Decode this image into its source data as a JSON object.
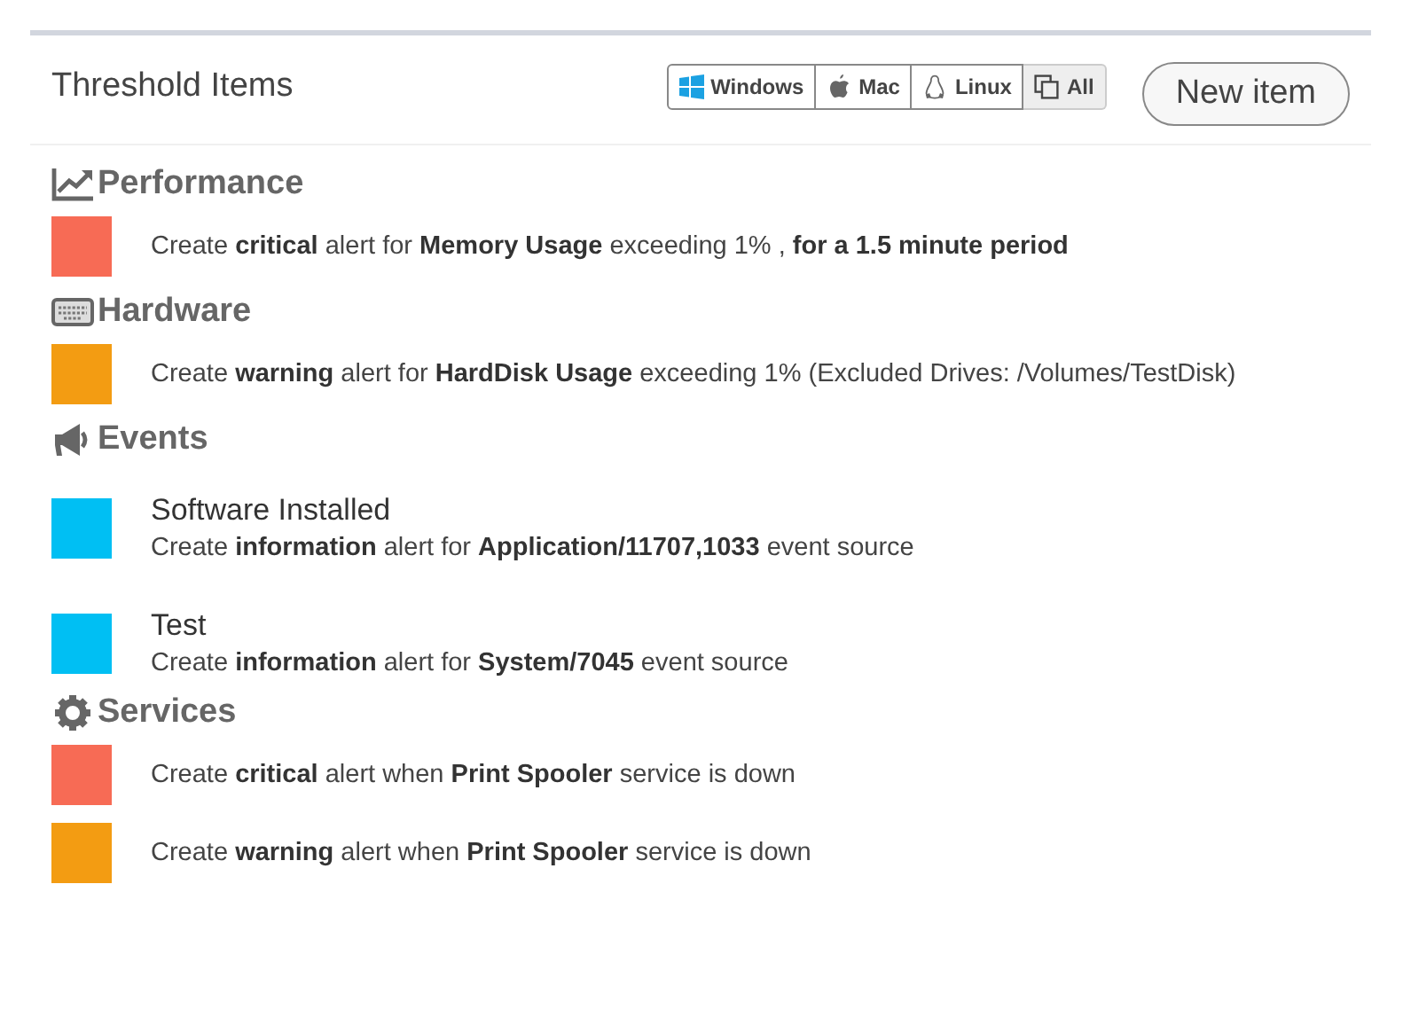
{
  "title": "Threshold Items",
  "filters": [
    {
      "label": "Windows",
      "kind": "windows",
      "selected": false
    },
    {
      "label": "Mac",
      "kind": "mac",
      "selected": false
    },
    {
      "label": "Linux",
      "kind": "linux",
      "selected": false
    },
    {
      "label": "All",
      "kind": "all",
      "selected": true
    }
  ],
  "new_button": "New item",
  "sections": [
    {
      "title": "Performance",
      "kind": "performance",
      "items": [
        {
          "color": "#f76b55",
          "text": "Create **critical** alert for **Memory Usage** exceeding 1% , **for a 1.5 minute period**"
        }
      ]
    },
    {
      "title": "Hardware",
      "kind": "hardware",
      "items": [
        {
          "color": "#f39c12",
          "text": "Create **warning** alert for **HardDisk Usage** exceeding 1% (Excluded Drives: /Volumes/TestDisk)"
        }
      ]
    },
    {
      "title": "Events",
      "kind": "events",
      "items": [
        {
          "color": "#00bff3",
          "name": "Software Installed",
          "text": "Create **information** alert for **Application/11707,1033** event source"
        },
        {
          "color": "#00bff3",
          "name": "Test",
          "text": "Create **information** alert for **System/7045** event source"
        }
      ]
    },
    {
      "title": "Services",
      "kind": "services",
      "items": [
        {
          "color": "#f76b55",
          "text": "Create **critical** alert when **Print Spooler** service is down"
        },
        {
          "color": "#f39c12",
          "text": "Create **warning** alert when **Print Spooler** service is down"
        }
      ]
    }
  ]
}
